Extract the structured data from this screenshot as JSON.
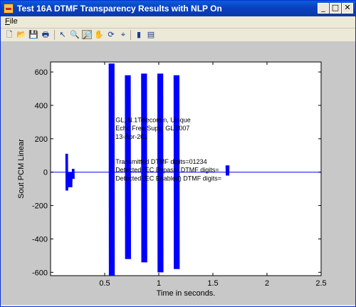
{
  "window": {
    "title": "Test 16A DTMF Transparency Results with NLP On",
    "buttons": {
      "minimize": "_",
      "maximize": "□",
      "close": "✕"
    }
  },
  "menu": {
    "items": [
      "File"
    ]
  },
  "toolbar": {
    "icons": [
      "new-file-icon",
      "open-folder-icon",
      "save-icon",
      "print-icon",
      "arrow-pointer-icon",
      "zoom-in-icon",
      "zoom-out-icon",
      "pan-hand-icon",
      "rotate-3d-icon",
      "data-cursor-icon",
      "colorbar-icon",
      "legend-icon"
    ],
    "glyphs": [
      "🗋",
      "📂",
      "💾",
      "🖶",
      "↖",
      "🔍",
      "🔎",
      "✋",
      "⟳",
      "⌖",
      "▮",
      "▤"
    ],
    "pressed": "zoom-out-icon"
  },
  "chart_data": {
    "type": "line",
    "xlabel": "Time in seconds.",
    "ylabel": "Sout PCM Linear",
    "xlim": [
      0,
      2.5
    ],
    "ylim": [
      -620,
      660
    ],
    "xticks": [
      0.5,
      1,
      1.5,
      2,
      2.5
    ],
    "yticks": [
      600,
      400,
      200,
      0,
      -200,
      -400,
      -600
    ],
    "grid": false,
    "line_color": "#0000ff",
    "series": [
      {
        "bursts": [
          {
            "x_start": 0.14,
            "x_end": 0.16,
            "y_max": 110,
            "y_min": -110
          },
          {
            "x_start": 0.16,
            "x_end": 0.2,
            "y_max": 0,
            "y_min": -90
          },
          {
            "x_start": 0.2,
            "x_end": 0.22,
            "y_max": 20,
            "y_min": -40
          },
          {
            "x_start": 0.54,
            "x_end": 0.59,
            "y_max": 650,
            "y_min": -620
          },
          {
            "x_start": 0.69,
            "x_end": 0.74,
            "y_max": 580,
            "y_min": -520
          },
          {
            "x_start": 0.84,
            "x_end": 0.89,
            "y_max": 590,
            "y_min": -540
          },
          {
            "x_start": 0.99,
            "x_end": 1.04,
            "y_max": 590,
            "y_min": -600
          },
          {
            "x_start": 1.14,
            "x_end": 1.19,
            "y_max": 580,
            "y_min": -580
          },
          {
            "x_start": 1.62,
            "x_end": 1.65,
            "y_max": 40,
            "y_min": -20
          }
        ]
      }
    ],
    "annotations": [
      {
        "x": 0.6,
        "y": 300,
        "text": "GL, N.1Telecom n, Unique"
      },
      {
        "x": 0.6,
        "y": 250,
        "text": "Echo Free Supp. GL 2007"
      },
      {
        "x": 0.6,
        "y": 200,
        "text": "13-Apr-201"
      },
      {
        "x": 0.6,
        "y": 50,
        "text": "Transmitted DTMF digits=01234"
      },
      {
        "x": 0.6,
        "y": 0,
        "text": "Detected (EC Bypass) DTMF digits="
      },
      {
        "x": 0.6,
        "y": -50,
        "text": "Detected (EC Enabled) DTMF digits="
      }
    ]
  }
}
